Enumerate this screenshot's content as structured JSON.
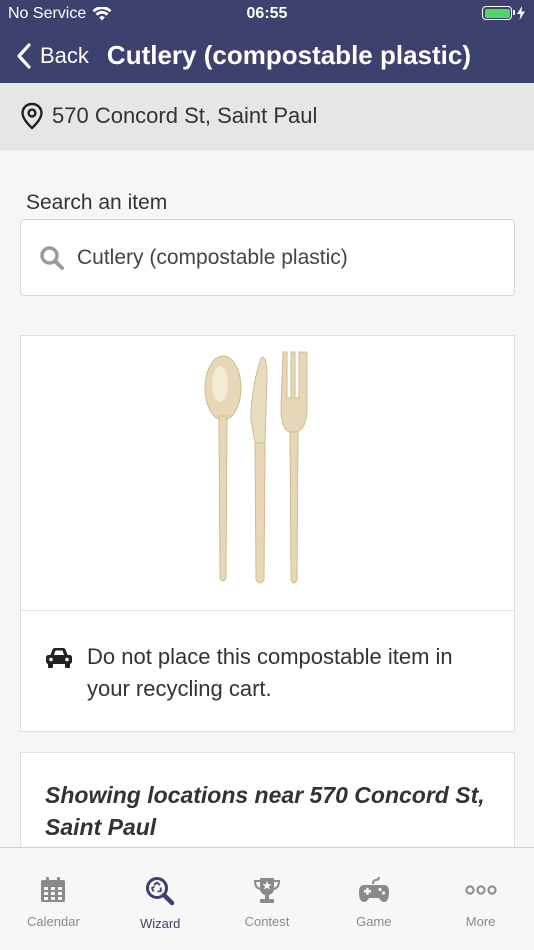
{
  "status_bar": {
    "carrier": "No Service",
    "time": "06:55",
    "battery_level": 1.0,
    "battery_color": "#4cd964"
  },
  "nav": {
    "back_label": "Back",
    "title": "Cutlery (compostable plastic)",
    "background_color": "#3c416e"
  },
  "address": {
    "icon": "location-pin-icon",
    "text": "570 Concord St, Saint Paul"
  },
  "search": {
    "label": "Search an item",
    "icon": "search-icon",
    "value": "Cutlery (compostable plastic)"
  },
  "item": {
    "image": "compostable-cutlery-image",
    "instruction_icon": "car-icon",
    "instruction": "Do not place this compostable item in your recycling cart."
  },
  "locations": {
    "heading": "Showing locations near 570 Concord St, Saint Paul"
  },
  "tab_bar": {
    "tabs": [
      {
        "label": "Calendar",
        "icon": "calendar-icon",
        "active": false
      },
      {
        "label": "Wizard",
        "icon": "recycle-search-icon",
        "active": true
      },
      {
        "label": "Contest",
        "icon": "trophy-icon",
        "active": false
      },
      {
        "label": "Game",
        "icon": "gamepad-icon",
        "active": false
      },
      {
        "label": "More",
        "icon": "more-icon",
        "active": false
      }
    ],
    "active_color": "#3c416e"
  }
}
